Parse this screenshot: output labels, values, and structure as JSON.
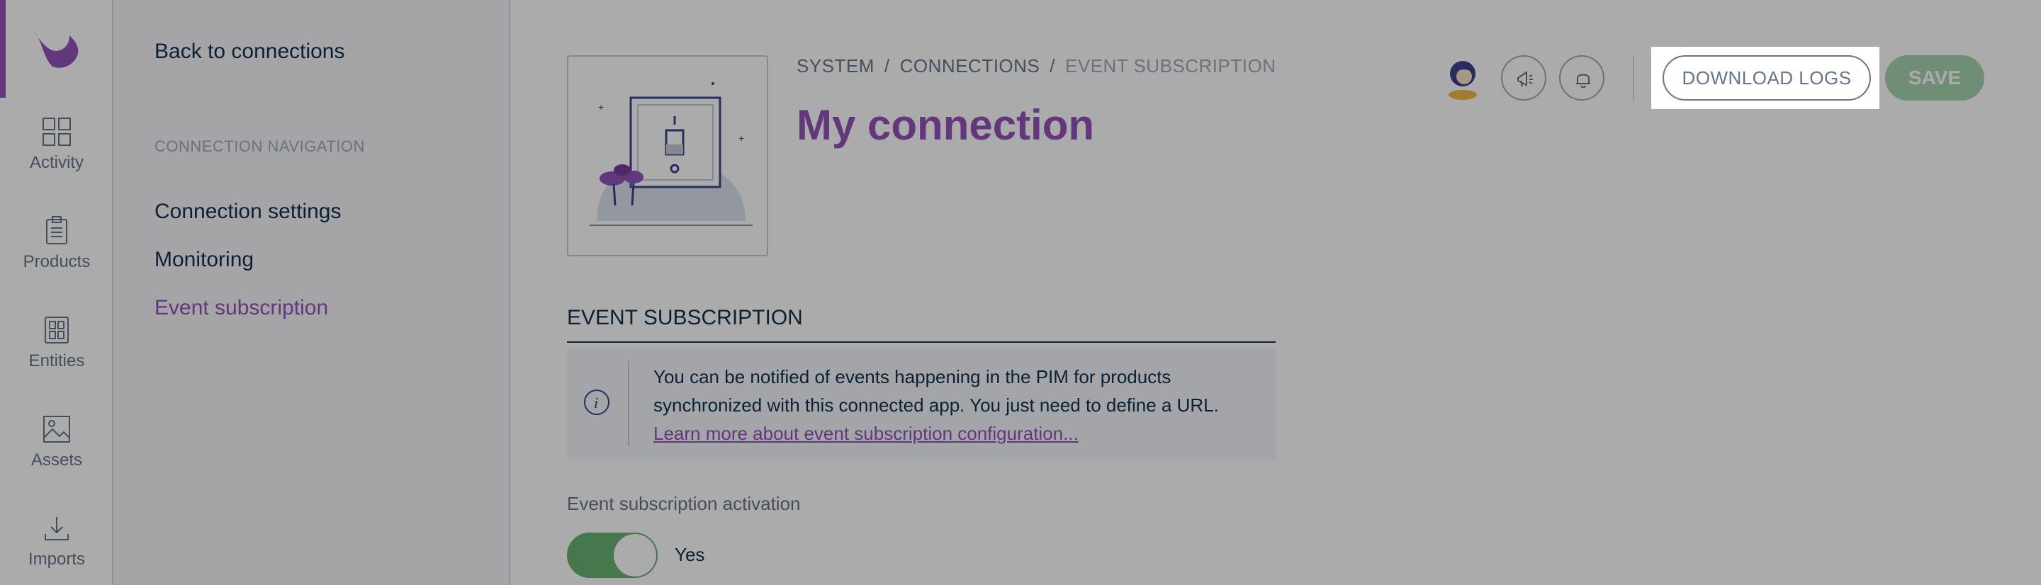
{
  "main_nav": {
    "items": [
      {
        "label": "Activity",
        "icon": "activity-icon"
      },
      {
        "label": "Products",
        "icon": "products-icon"
      },
      {
        "label": "Entities",
        "icon": "entities-icon"
      },
      {
        "label": "Assets",
        "icon": "assets-icon"
      },
      {
        "label": "Imports",
        "icon": "imports-icon"
      }
    ]
  },
  "column": {
    "back_link": "Back to connections",
    "section_title": "CONNECTION NAVIGATION",
    "items": [
      {
        "label": "Connection settings"
      },
      {
        "label": "Monitoring"
      },
      {
        "label": "Event subscription"
      }
    ]
  },
  "header": {
    "breadcrumb": [
      "SYSTEM",
      "CONNECTIONS",
      "EVENT SUBSCRIPTION"
    ],
    "title": "My connection",
    "download_logs_label": "DOWNLOAD LOGS",
    "save_label": "SAVE"
  },
  "section": {
    "title": "EVENT SUBSCRIPTION",
    "helper_text": "You can be notified of events happening in the PIM for products synchronized with this connected app. You just need to define a URL.",
    "helper_link": "Learn more about event subscription configuration...",
    "activation_label": "Event subscription activation",
    "activation_value": "Yes"
  },
  "colors": {
    "brand_purple": "#9452ba",
    "text_dark": "#11324d",
    "text_grey": "#67768a",
    "save_green": "#a7d4b0",
    "toggle_green": "#67b373"
  }
}
